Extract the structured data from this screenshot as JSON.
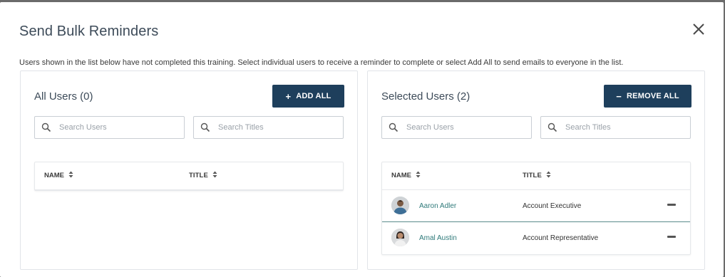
{
  "modal": {
    "title": "Send Bulk Reminders",
    "description": "Users shown in the list below have not completed this training. Select individual users to receive a reminder to complete or select Add All to send emails to everyone in the list."
  },
  "all_users": {
    "title": "All Users (0)",
    "button_label": "ADD ALL",
    "button_icon": "+",
    "search_users_placeholder": "Search Users",
    "search_titles_placeholder": "Search Titles",
    "columns": {
      "name": "NAME",
      "title": "TITLE"
    },
    "rows": []
  },
  "selected_users": {
    "title": "Selected Users (2)",
    "button_label": "REMOVE ALL",
    "button_icon": "−",
    "search_users_placeholder": "Search Users",
    "search_titles_placeholder": "Search Titles",
    "columns": {
      "name": "NAME",
      "title": "TITLE"
    },
    "rows": [
      {
        "name": "Aaron Adler",
        "title": "Account Executive"
      },
      {
        "name": "Amal Austin",
        "title": "Account Representative"
      }
    ]
  },
  "colors": {
    "primary_button": "#1e3f5c",
    "link": "#2f7a7a",
    "heading": "#3d4b59"
  }
}
